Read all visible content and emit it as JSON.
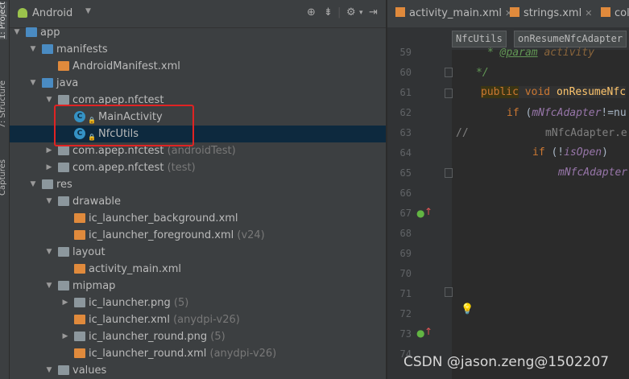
{
  "toolstrip": {
    "project": "1: Project",
    "structure": "7: Structure",
    "captures": "Captures"
  },
  "project": {
    "view_selector": "Android",
    "tree": [
      {
        "label": "app",
        "muted": ""
      },
      {
        "label": "manifests",
        "muted": ""
      },
      {
        "label": "AndroidManifest.xml",
        "muted": ""
      },
      {
        "label": "java",
        "muted": ""
      },
      {
        "label": "com.apep.nfctest",
        "muted": ""
      },
      {
        "label": "MainActivity",
        "muted": ""
      },
      {
        "label": "NfcUtils",
        "muted": ""
      },
      {
        "label": "com.apep.nfctest",
        "muted": "(androidTest)"
      },
      {
        "label": "com.apep.nfctest",
        "muted": "(test)"
      },
      {
        "label": "res",
        "muted": ""
      },
      {
        "label": "drawable",
        "muted": ""
      },
      {
        "label": "ic_launcher_background.xml",
        "muted": ""
      },
      {
        "label": "ic_launcher_foreground.xml",
        "muted": "(v24)"
      },
      {
        "label": "layout",
        "muted": ""
      },
      {
        "label": "activity_main.xml",
        "muted": ""
      },
      {
        "label": "mipmap",
        "muted": ""
      },
      {
        "label": "ic_launcher.png",
        "muted": "(5)"
      },
      {
        "label": "ic_launcher.xml",
        "muted": "(anydpi-v26)"
      },
      {
        "label": "ic_launcher_round.png",
        "muted": "(5)"
      },
      {
        "label": "ic_launcher_round.xml",
        "muted": "(anydpi-v26)"
      },
      {
        "label": "values",
        "muted": ""
      }
    ]
  },
  "editor": {
    "tabs": [
      "activity_main.xml",
      "strings.xml",
      "col"
    ],
    "breadcrumbs": [
      "NfcUtils",
      "onResumeNfcAdapter"
    ],
    "line_numbers": [
      "59",
      "60",
      "61",
      "62",
      "63",
      "64",
      "65",
      "66",
      "67",
      "68",
      "69",
      "70",
      "71",
      "72",
      "73",
      "74"
    ],
    "code": {
      "l59a": "* ",
      "l59b": "@param",
      "l59c": " activity",
      "l60": "*/",
      "l61a": "public",
      "l61b": " void ",
      "l61c": "onResumeNfc",
      "l62a": "if",
      "l62b": " (",
      "l62c": "mNfcAdapter",
      "l62d": "!=nu",
      "l63a": "//",
      "l63b": "mNfcAdapter.e",
      "l64a": "if",
      "l64b": " (!",
      "l64c": "isOpen",
      "l64d": ")",
      "l65": "mNfcAdapter"
    }
  },
  "watermark": "CSDN @jason.zeng@1502207",
  "colors": {
    "selection": "#0d293e",
    "highlight_box": "#e02323",
    "keyword": "#cc7832",
    "method": "#ffc66d"
  }
}
